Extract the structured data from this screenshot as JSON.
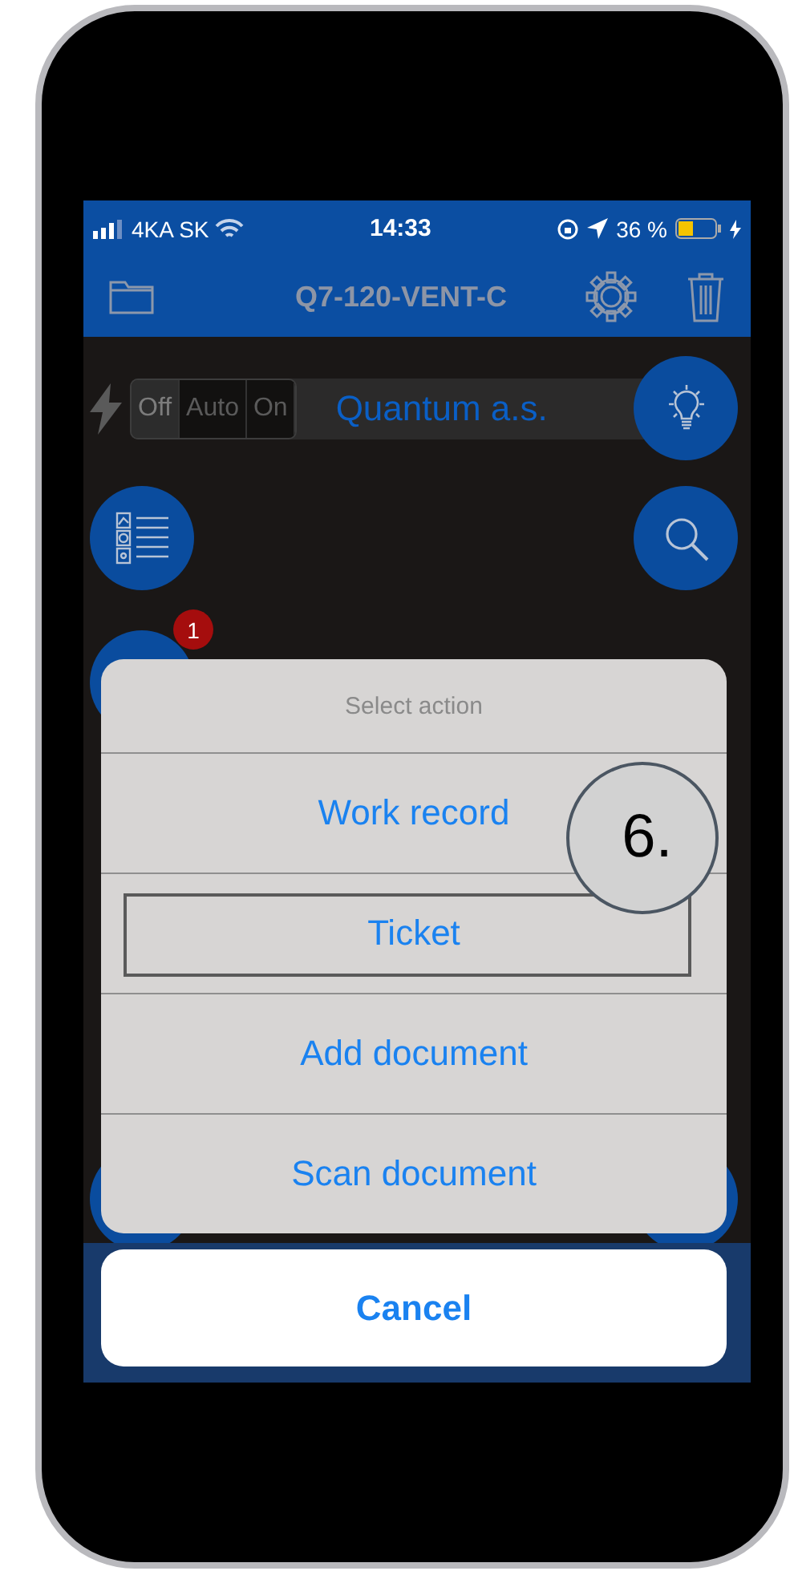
{
  "status_bar": {
    "carrier": "4KA SK",
    "time": "14:33",
    "battery": "36 %"
  },
  "nav_bar": {
    "title": "Q7-120-VENT-C"
  },
  "mode_toggle": {
    "segments": [
      {
        "label": "Off",
        "selected": true
      },
      {
        "label": "Auto",
        "selected": false
      },
      {
        "label": "On",
        "selected": false
      }
    ]
  },
  "company": "Quantum a.s.",
  "badge": "1",
  "action_sheet": {
    "title": "Select action",
    "actions": [
      {
        "label": "Work record",
        "highlighted": false
      },
      {
        "label": "Ticket",
        "highlighted": true
      },
      {
        "label": "Add document",
        "highlighted": false
      },
      {
        "label": "Scan document",
        "highlighted": false
      }
    ],
    "cancel": "Cancel"
  },
  "callout": "6."
}
